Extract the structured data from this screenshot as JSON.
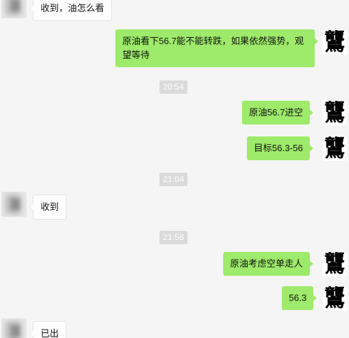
{
  "avatars": {
    "self_glyph": "鸗"
  },
  "messages": {
    "m1": "收到，油怎么看",
    "m2": "原油看下56.7能不能转跌，如果依然强势，观望等待",
    "m3": "原油56.7进空",
    "m4": "目标56.3-56",
    "m5": "收到",
    "m6": "原油考虑空单走人",
    "m7": "56.3",
    "m8": "已出"
  },
  "timestamps": {
    "t1": "20:54",
    "t2": "21:04",
    "t3": "21:58"
  },
  "colors": {
    "background": "#f5f5f5",
    "outgoing_bubble": "#9eea6a",
    "incoming_bubble": "#ffffff",
    "timestamp_bg": "#dadada"
  }
}
